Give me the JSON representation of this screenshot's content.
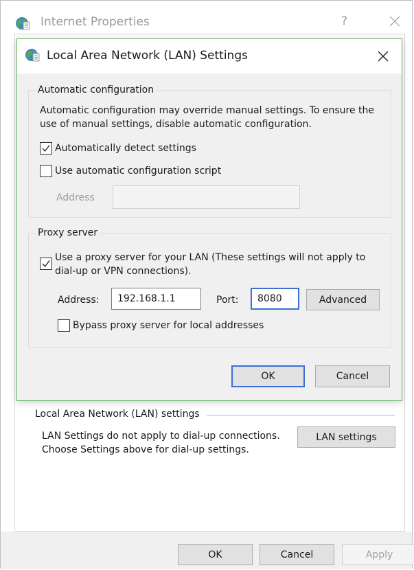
{
  "outer": {
    "title": "Internet Properties",
    "help": "?",
    "lan_group": {
      "title": "Local Area Network (LAN) settings",
      "note": "LAN Settings do not apply to dial-up connections. Choose Settings above for dial-up settings.",
      "button": "LAN settings"
    },
    "footer": {
      "ok": "OK",
      "cancel": "Cancel",
      "apply": "Apply"
    }
  },
  "dialog": {
    "title": "Local Area Network (LAN) Settings",
    "auto": {
      "group_label": "Automatic configuration",
      "description": "Automatic configuration may override manual settings.  To ensure the use of manual settings, disable automatic configuration.",
      "detect_label": "Automatically detect settings",
      "detect_checked": true,
      "script_label": "Use automatic configuration script",
      "script_checked": false,
      "address_label": "Address",
      "address_value": ""
    },
    "proxy": {
      "group_label": "Proxy server",
      "use_proxy_label": "Use a proxy server for your LAN (These settings will not apply to dial-up or VPN connections).",
      "use_proxy_checked": true,
      "address_label": "Address:",
      "address_value": "192.168.1.1",
      "port_label": "Port:",
      "port_value": "8080",
      "advanced": "Advanced",
      "bypass_label": "Bypass proxy server for local addresses",
      "bypass_checked": false
    },
    "ok": "OK",
    "cancel": "Cancel"
  },
  "icons": {
    "globe": "internet-options-globe-icon",
    "close": "close-icon",
    "check": "checkmark-icon"
  },
  "colors": {
    "accent": "#3b6fd4",
    "dialog_border": "#5fb35c",
    "window_bg": "#f0f0f0"
  }
}
